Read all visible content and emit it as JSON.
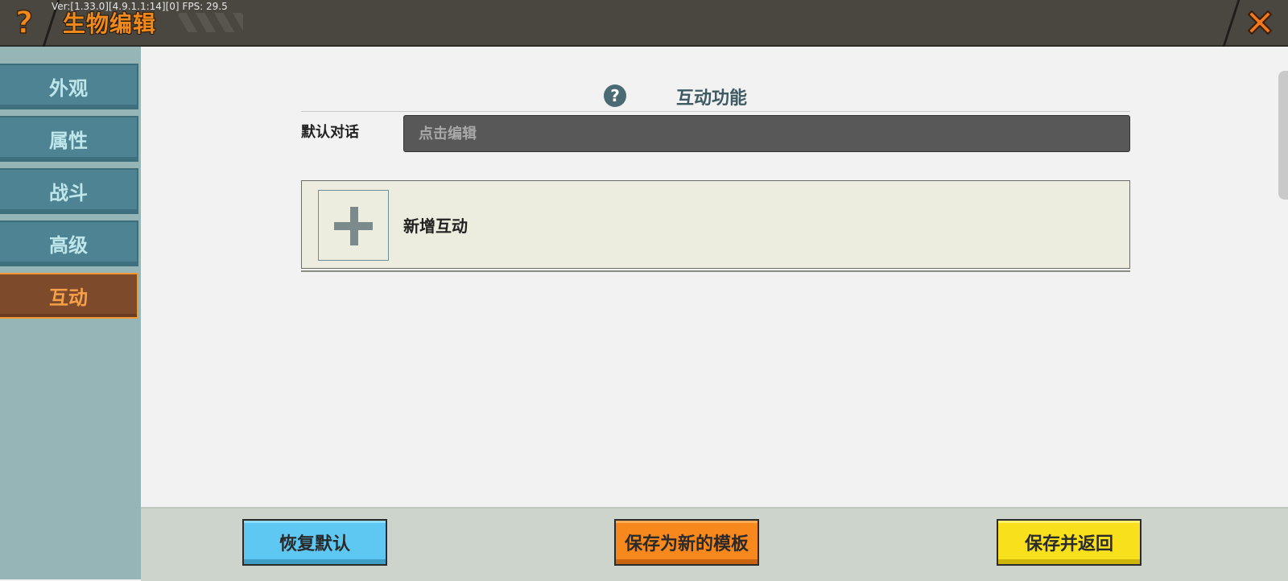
{
  "header": {
    "help_icon": "question-mark-icon",
    "help_glyph": "?",
    "title": "生物编辑",
    "version_text": "Ver:[1.33.0][4.9.1.1:14][0] FPS: 29.5",
    "close_icon": "close-icon"
  },
  "sidebar": {
    "items": [
      {
        "label": "外观",
        "active": false
      },
      {
        "label": "属性",
        "active": false
      },
      {
        "label": "战斗",
        "active": false
      },
      {
        "label": "高级",
        "active": false
      },
      {
        "label": "互动",
        "active": true
      }
    ]
  },
  "main": {
    "section_help_glyph": "?",
    "section_title": "互动功能",
    "default_dialog_label": "默认对话",
    "default_dialog_placeholder": "点击编辑",
    "default_dialog_value": "",
    "add_interaction_label": "新增互动"
  },
  "footer": {
    "restore_label": "恢复默认",
    "save_template_label": "保存为新的模板",
    "save_return_label": "保存并返回"
  },
  "colors": {
    "accent_orange": "#f08a1d",
    "sidebar_item": "#4d8392",
    "sidebar_active": "#7d4a2c",
    "restore_btn": "#5fc8f2",
    "template_btn": "#f7881e",
    "save_btn": "#f9e01c"
  }
}
